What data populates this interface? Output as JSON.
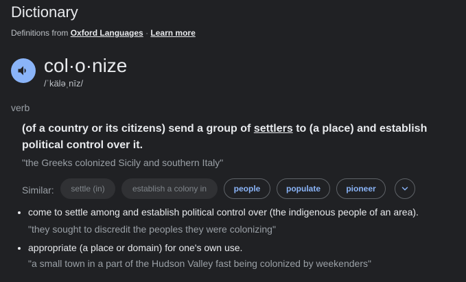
{
  "header": {
    "title": "Dictionary",
    "source_prefix": "Definitions from",
    "source_link": "Oxford Languages",
    "separator": "·",
    "learn_more": "Learn more"
  },
  "entry": {
    "headword": "col·o·nize",
    "phonetic": "/ˈkäləˌnīz/",
    "part_of_speech": "verb",
    "definition_pre": "(of a country or its citizens) send a group of",
    "definition_link": "settlers",
    "definition_post": "to (a place) and establish political control over it.",
    "example": "\"the Greeks colonized Sicily and southern Italy\"",
    "similar_label": "Similar:",
    "similar": [
      {
        "label": "settle (in)",
        "state": "dim"
      },
      {
        "label": "establish a colony in",
        "state": "dim"
      },
      {
        "label": "people",
        "state": "active"
      },
      {
        "label": "populate",
        "state": "active"
      },
      {
        "label": "pioneer",
        "state": "active"
      }
    ],
    "sub_senses": [
      {
        "definition": "come to settle among and establish political control over (the indigenous people of an area).",
        "example": "\"they sought to discredit the peoples they were colonizing\""
      },
      {
        "definition": "appropriate (a place or domain) for one's own use.",
        "example": "\"a small town in a part of the Hudson Valley fast being colonized by weekenders\""
      }
    ]
  },
  "icons": {
    "speaker": "volume-icon",
    "expand": "chevron-down-icon"
  },
  "colors": {
    "background": "#202124",
    "accent": "#8ab4f8",
    "text": "#e8eaed",
    "muted": "#9aa0a6"
  }
}
